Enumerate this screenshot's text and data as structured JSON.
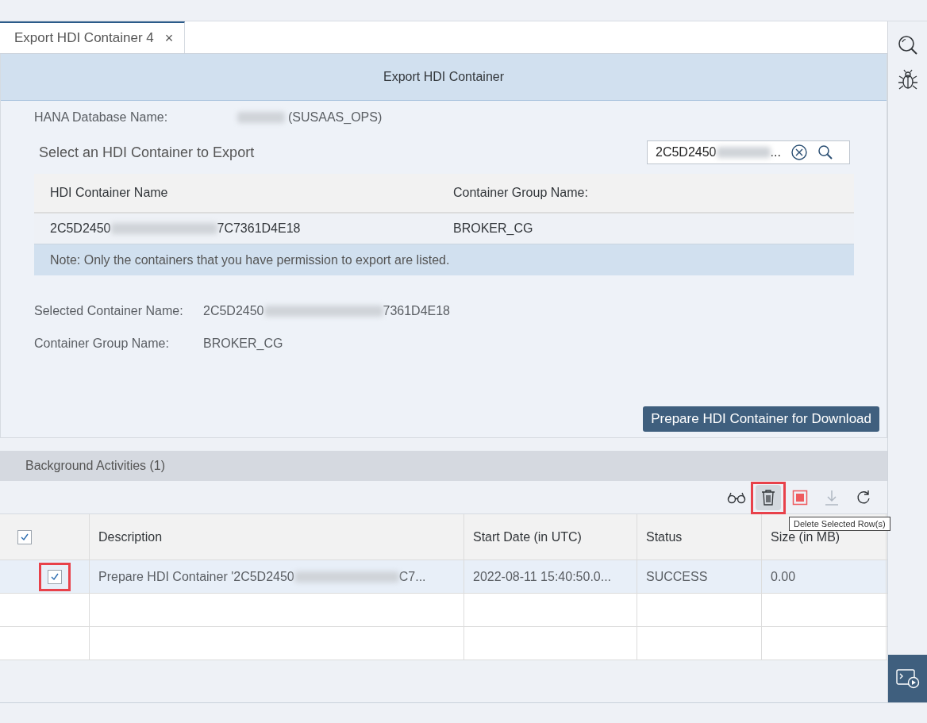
{
  "tab": {
    "label": "Export HDI Container 4",
    "close": "×",
    "selected": true
  },
  "panel": {
    "title": "Export HDI Container",
    "database": {
      "label": "HANA Database Name:",
      "value_after_blur": "(SUSAAS_OPS)"
    },
    "section_title": "Select an HDI Container to Export",
    "search": {
      "value_start": "2C5D2450",
      "value_end": "..."
    },
    "table": {
      "columns": [
        "HDI Container Name",
        "Container Group Name:"
      ],
      "rows": [
        {
          "name_start": "2C5D2450",
          "name_end": "7C7361D4E18",
          "group": "BROKER_CG"
        }
      ],
      "note": "Note: Only the containers that you have permission to export are listed."
    },
    "selected_name": {
      "label": "Selected Container Name:",
      "value_start": "2C5D2450",
      "value_end": "7361D4E18"
    },
    "selected_group": {
      "label": "Container Group Name:",
      "value": "BROKER_CG"
    },
    "prepare_button": "Prepare HDI Container for Download"
  },
  "activities": {
    "title": "Background Activities (1)",
    "toolbar": [
      {
        "kind": "view",
        "highlighted": false,
        "disabled": false
      },
      {
        "kind": "delete",
        "highlighted": true,
        "disabled": false
      },
      {
        "kind": "stop",
        "highlighted": false,
        "disabled": false
      },
      {
        "kind": "download",
        "highlighted": false,
        "disabled": true
      },
      {
        "kind": "refresh",
        "highlighted": false,
        "disabled": false
      }
    ],
    "tooltip": "Delete Selected Row(s)",
    "all_checked": true,
    "columns": [
      "Description",
      "Start Date (in UTC)",
      "Status",
      "Size (in MB)"
    ],
    "rows": [
      {
        "kind": "item",
        "checked": true,
        "selected": true,
        "highlighted": true,
        "description_start": "Prepare HDI Container '2C5D2450",
        "description_end": "C7...",
        "start_date": "2022-08-11 15:40:50.0...",
        "status": "SUCCESS",
        "size": "0.00"
      },
      {
        "kind": "empty"
      },
      {
        "kind": "empty"
      }
    ]
  }
}
